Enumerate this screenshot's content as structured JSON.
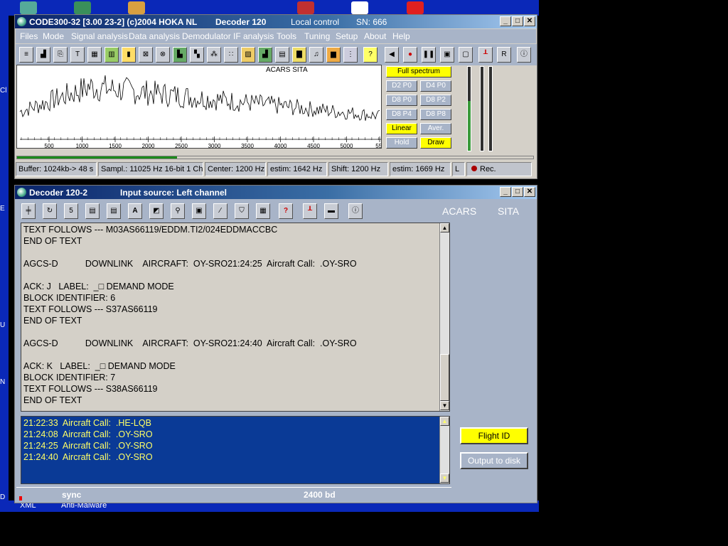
{
  "desktop": {
    "bottom_labels": [
      "XML",
      "Anti-Malware"
    ],
    "edge_letters": [
      "Cl",
      "E",
      "U",
      "N",
      "D"
    ]
  },
  "main_window": {
    "title": "CODE300-32 [3.00 23-2] (c)2004 HOKA NL",
    "decoder": "Decoder 120",
    "control": "Local control",
    "serial": "SN: 666",
    "menu": [
      "Files",
      "Mode",
      "Signal analysis",
      "Data analysis",
      "Demodulator",
      "IF analysis",
      "Tools",
      "Tuning",
      "Setup",
      "About",
      "Help"
    ],
    "spectrum_label": "ACARS SITA",
    "ticks": [
      "500",
      "1000",
      "1500",
      "2000",
      "2500",
      "3000",
      "3500",
      "4000",
      "4500",
      "5000",
      "55("
    ],
    "spectrum_buttons": {
      "full": "Full spectrum",
      "d2p0": "D2 P0",
      "d4p0": "D4 P0",
      "d8p0": "D8 P0",
      "d8p2": "D8 P2",
      "d8p4": "D8 P4",
      "d8p8": "D8 P8",
      "linear": "Linear",
      "aver": "Aver.",
      "hold": "Hold",
      "draw": "Draw"
    },
    "status": {
      "buffer": "Buffer: 1024kb-> 48 s",
      "sampling": "Sampl.: 11025 Hz 16-bit 1 Ch",
      "center": "Center: 1200 Hz",
      "estim1": "estim: 1642 Hz",
      "shift": "Shift: 1200 Hz",
      "estim2": "estim: 1669 Hz",
      "channel": "L",
      "rec": "Rec."
    },
    "progress": 0.31
  },
  "decoder_window": {
    "title": "Decoder 120-2",
    "input_source": "Input source: Left channel",
    "mode_acars": "ACARS",
    "mode_sita": "SITA",
    "lines": [
      "TEXT FOLLOWS --- M03AS66119/EDDM.TI2/024EDDMACCBC",
      "END OF TEXT",
      "",
      "AGCS-D           DOWNLINK    AIRCRAFT:  OY-SRO21:24:25  Aircraft Call:  .OY-SRO",
      "",
      "ACK: J   LABEL:  _□ DEMAND MODE",
      "BLOCK IDENTIFIER: 6",
      "TEXT FOLLOWS --- S37AS66119",
      "END OF TEXT",
      "",
      "AGCS-D           DOWNLINK    AIRCRAFT:  OY-SRO21:24:40  Aircraft Call:  .OY-SRO",
      "",
      "ACK: K   LABEL:  _□ DEMAND MODE",
      "BLOCK IDENTIFIER: 7",
      "TEXT FOLLOWS --- S38AS66119",
      "END OF TEXT"
    ],
    "calls": [
      "21:22:33  Aircraft Call:  .HE-LQB",
      "21:24:08  Aircraft Call:  .OY-SRO",
      "21:24:25  Aircraft Call:  .OY-SRO",
      "21:24:40  Aircraft Call:  .OY-SRO"
    ],
    "flight_id": "Flight ID",
    "output_to_disk": "Output to disk",
    "sync": "sync",
    "baud": "2400 bd"
  }
}
